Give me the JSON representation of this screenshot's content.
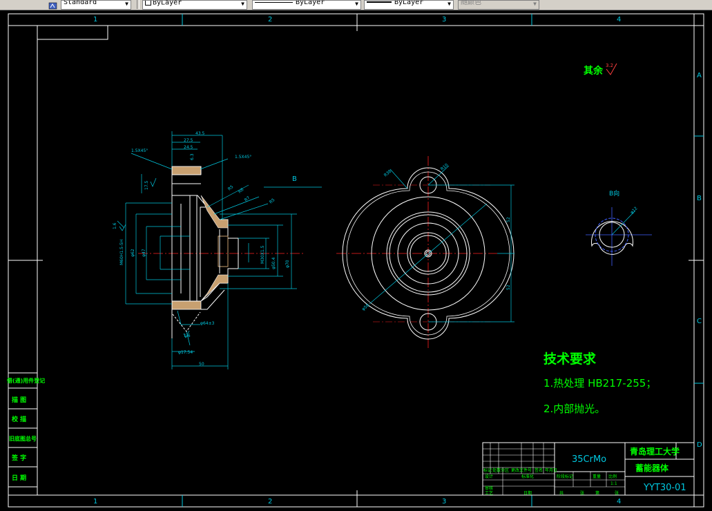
{
  "toolbar": {
    "text_style": "Standard",
    "layer": "ByLayer",
    "linetype": "ByLayer",
    "lineweight": "ByLayer",
    "plot_style": "随颜色"
  },
  "border": {
    "top_zones": [
      "1",
      "2",
      "3",
      "4"
    ],
    "bottom_zones": [
      "1",
      "2",
      "3",
      "4"
    ],
    "right_zones": [
      "A",
      "B",
      "C",
      "D"
    ]
  },
  "surface_note": {
    "text": "其余",
    "value": "3.2"
  },
  "view_b_label": "B",
  "view_b_title": "B向",
  "tech_req": {
    "title": "技术要求",
    "items": [
      "1.热处理 HB217-255；",
      "2.内部抛光。"
    ]
  },
  "title_block": {
    "material": "35CrMo",
    "school": "青岛理工大学",
    "part_name": "蓄能器体",
    "drawing_no": "YYT30-01",
    "scale": "1:1",
    "cells": [
      "标记",
      "处数",
      "分区",
      "更改文件号",
      "签名",
      "年月日",
      "设计",
      "标准化",
      "阶段标记",
      "重量",
      "比例",
      "审核",
      "工艺",
      "日期",
      "共",
      "张",
      "第",
      "张"
    ]
  },
  "side_table": [
    "借(通)用件登记",
    "描 图",
    "校 描",
    "旧底图总号",
    "签 字",
    "日 期"
  ],
  "dims": {
    "d1": "1.5X45°",
    "d2": "1.5X45°",
    "d3": "43.5",
    "d4": "27.5",
    "d5": "24.5",
    "d6": "6.3",
    "d7": "M60H1.5-5H",
    "d8": "φ62",
    "d9": "φ47",
    "d10": "φ50.4",
    "d11": "φ70",
    "d12": "M30X1.5",
    "d13": "φ17.54",
    "d14": "50",
    "d15": "φ64±3",
    "d16": "R5",
    "d17": "R6",
    "d18": "R7",
    "d19": "R5",
    "d20": "1.6",
    "d21": "1.6",
    "d22": "R10",
    "d23": "R38",
    "d24": "φ58",
    "d25": "52",
    "d26": "52",
    "d27": "R6",
    "d28": "φ12",
    "d29": "17.5"
  }
}
